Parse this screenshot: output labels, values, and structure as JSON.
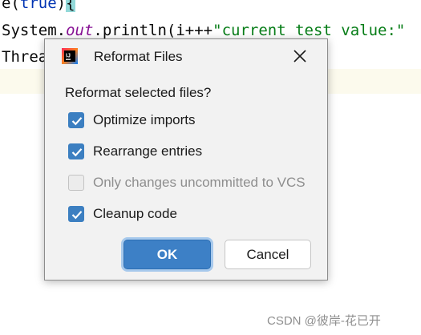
{
  "editor": {
    "line1": {
      "tail": "e(",
      "kw": "true",
      "close": ")",
      "brace": "{"
    },
    "line2": {
      "prefix": "System.",
      "field": "out",
      "middle": ".println(i+++",
      "string": "\"current test value:\""
    },
    "line3": {
      "text": "Threa"
    }
  },
  "dialog": {
    "title": "Reformat Files",
    "app_icon_letters": "IJ",
    "close_glyph": "✕",
    "prompt": "Reformat selected files?",
    "options": [
      {
        "label": "Optimize imports",
        "checked": true,
        "enabled": true
      },
      {
        "label": "Rearrange entries",
        "checked": true,
        "enabled": true
      },
      {
        "label": "Only changes uncommitted to VCS",
        "checked": false,
        "enabled": false
      },
      {
        "label": "Cleanup code",
        "checked": true,
        "enabled": true
      }
    ],
    "ok_label": "OK",
    "cancel_label": "Cancel"
  },
  "watermark": "CSDN @彼岸-花已开",
  "colors": {
    "accent": "#3d80c6",
    "checkbox_checked": "#3c7fc1",
    "keyword": "#0033b3",
    "string": "#067d17",
    "field": "#871094"
  }
}
